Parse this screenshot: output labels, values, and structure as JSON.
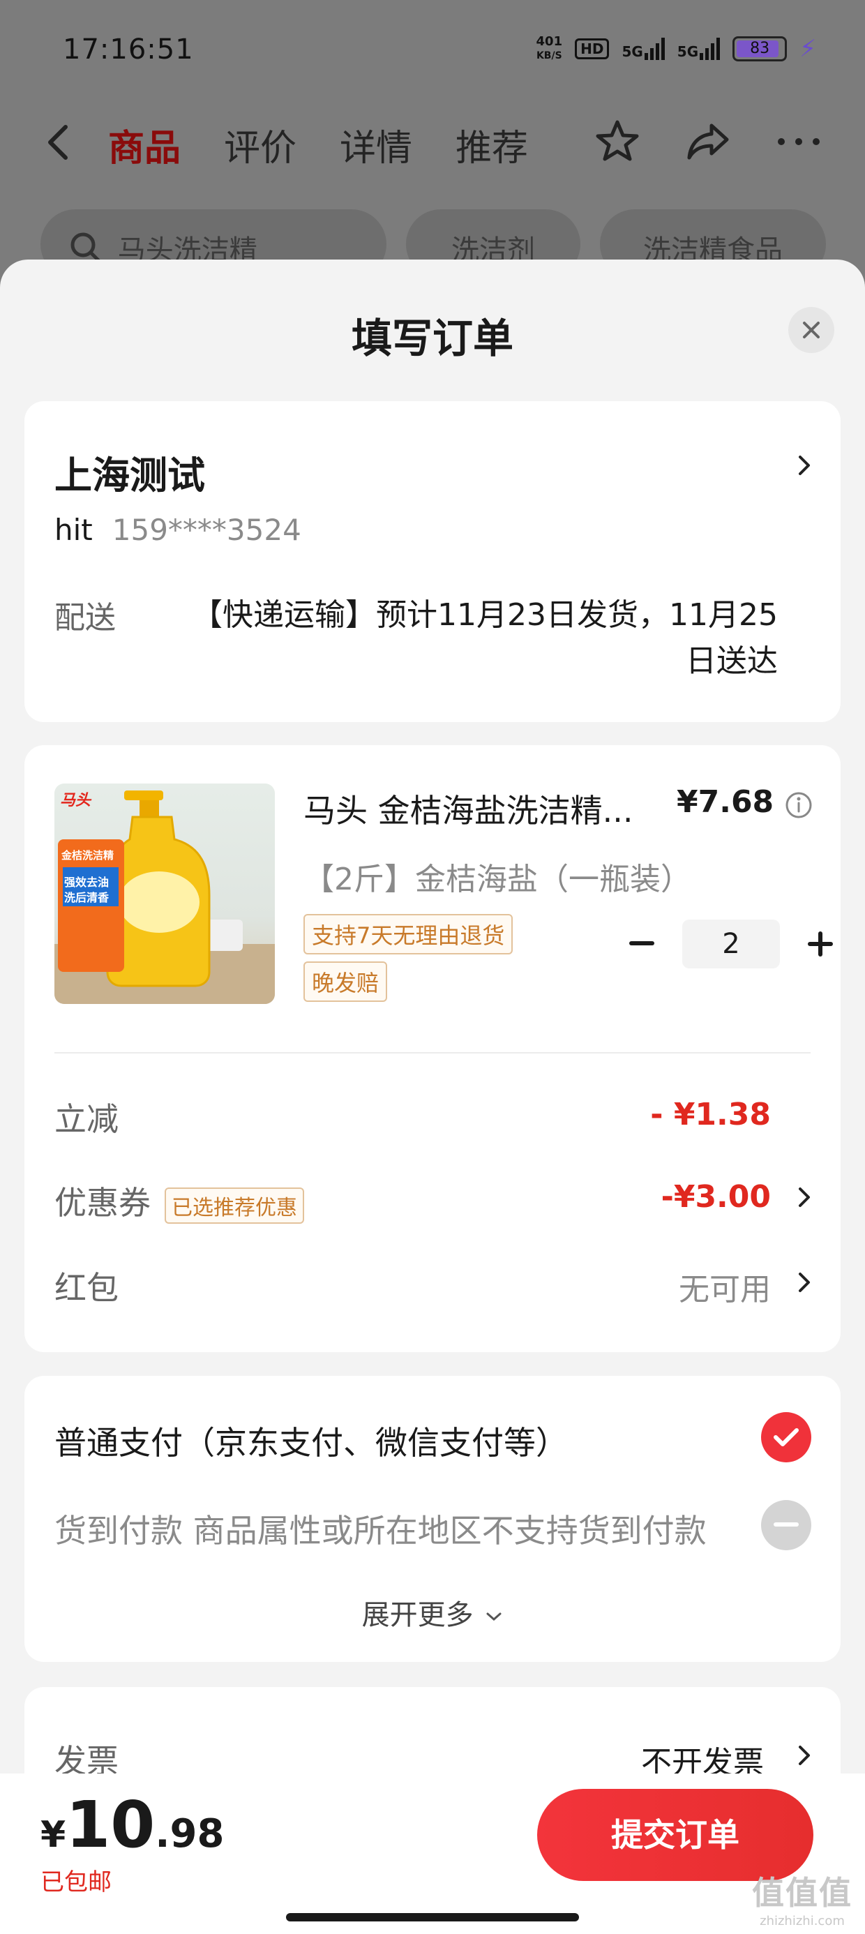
{
  "status_bar": {
    "time": "17:16:51",
    "net_speed_value": "401",
    "net_speed_unit": "KB/S",
    "hd_badge": "HD",
    "signal_1": "5G",
    "signal_2": "5G",
    "battery": "83",
    "battery_level": 0.83
  },
  "nav": {
    "tabs": [
      {
        "label": "商品",
        "active": true
      },
      {
        "label": "评价",
        "active": false
      },
      {
        "label": "详情",
        "active": false
      },
      {
        "label": "推荐",
        "active": false
      }
    ]
  },
  "search": {
    "query": "马头洗洁精",
    "chips": [
      "洗洁剂",
      "洗洁精食品"
    ]
  },
  "sheet": {
    "title": "填写订单"
  },
  "address": {
    "name": "上海测试",
    "contact_name": "hit",
    "phone": "159****3524",
    "delivery_label": "配送",
    "delivery_text_line1": "【快递运输】预计11月23日发货，11月25",
    "delivery_text_line2": "日送达"
  },
  "product": {
    "title": "马头 金桔海盐洗洁精...",
    "price": "¥7.68",
    "spec": "【2斤】金桔海盐（一瓶装）",
    "tags": [
      "支持7天无理由退货",
      "晚发赔"
    ],
    "quantity": "2",
    "image_texts": {
      "brand": "马头",
      "line1": "金桔洗洁精",
      "line2": "强效去油",
      "line3": "洗后清香"
    }
  },
  "discounts": {
    "instant_label": "立减",
    "instant_value": "- ¥1.38",
    "coupon_label": "优惠券",
    "coupon_tag": "已选推荐优惠",
    "coupon_value": "-¥3.00",
    "redpacket_label": "红包",
    "redpacket_value": "无可用"
  },
  "payment": {
    "normal": "普通支付（京东支付、微信支付等）",
    "cod": "货到付款 商品属性或所在地区不支持货到付款",
    "expand": "展开更多"
  },
  "invoice": {
    "label": "发票",
    "value": "不开发票"
  },
  "bottom": {
    "currency": "¥",
    "total_int": "10",
    "total_dec": ".98",
    "shipping": "已包邮",
    "submit": "提交订单"
  },
  "watermark": {
    "main": "值值值",
    "sub": "zhizhizhi.com"
  },
  "colors": {
    "accent_red": "#e0281f",
    "tag_orange": "#c87a2a",
    "check_red": "#f0323a"
  }
}
